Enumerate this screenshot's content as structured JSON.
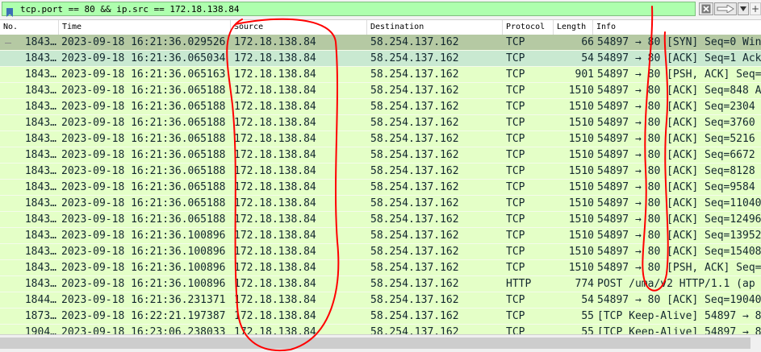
{
  "filter": {
    "expression": "tcp.port == 80 && ip.src == 172.18.138.84"
  },
  "columns": {
    "no": "No.",
    "time": "Time",
    "source": "Source",
    "destination": "Destination",
    "protocol": "Protocol",
    "length": "Length",
    "info": "Info"
  },
  "colors": {
    "filter_valid": "#aeffae",
    "row_tcp": "#e4ffc7",
    "row_selected": "#b5c9a3",
    "row_related": "#c9e9d1",
    "annotation": "#ff0000"
  },
  "packets": [
    {
      "no": "1843…",
      "time": "2023-09-18 16:21:36.029526",
      "source": "172.18.138.84",
      "destination": "58.254.137.162",
      "protocol": "TCP",
      "length": "66",
      "info": "54897 → 80 [SYN] Seq=0 Win",
      "state": "selected"
    },
    {
      "no": "1843…",
      "time": "2023-09-18 16:21:36.065034",
      "source": "172.18.138.84",
      "destination": "58.254.137.162",
      "protocol": "TCP",
      "length": "54",
      "info": "54897 → 80 [ACK] Seq=1 Ack",
      "state": "related"
    },
    {
      "no": "1843…",
      "time": "2023-09-18 16:21:36.065163",
      "source": "172.18.138.84",
      "destination": "58.254.137.162",
      "protocol": "TCP",
      "length": "901",
      "info": "54897 → 80 [PSH, ACK] Seq=",
      "state": "normal"
    },
    {
      "no": "1843…",
      "time": "2023-09-18 16:21:36.065188",
      "source": "172.18.138.84",
      "destination": "58.254.137.162",
      "protocol": "TCP",
      "length": "1510",
      "info": "54897 → 80 [ACK] Seq=848 A",
      "state": "normal"
    },
    {
      "no": "1843…",
      "time": "2023-09-18 16:21:36.065188",
      "source": "172.18.138.84",
      "destination": "58.254.137.162",
      "protocol": "TCP",
      "length": "1510",
      "info": "54897 → 80 [ACK] Seq=2304",
      "state": "normal"
    },
    {
      "no": "1843…",
      "time": "2023-09-18 16:21:36.065188",
      "source": "172.18.138.84",
      "destination": "58.254.137.162",
      "protocol": "TCP",
      "length": "1510",
      "info": "54897 → 80 [ACK] Seq=3760",
      "state": "normal"
    },
    {
      "no": "1843…",
      "time": "2023-09-18 16:21:36.065188",
      "source": "172.18.138.84",
      "destination": "58.254.137.162",
      "protocol": "TCP",
      "length": "1510",
      "info": "54897 → 80 [ACK] Seq=5216",
      "state": "normal"
    },
    {
      "no": "1843…",
      "time": "2023-09-18 16:21:36.065188",
      "source": "172.18.138.84",
      "destination": "58.254.137.162",
      "protocol": "TCP",
      "length": "1510",
      "info": "54897 → 80 [ACK] Seq=6672",
      "state": "normal"
    },
    {
      "no": "1843…",
      "time": "2023-09-18 16:21:36.065188",
      "source": "172.18.138.84",
      "destination": "58.254.137.162",
      "protocol": "TCP",
      "length": "1510",
      "info": "54897 → 80 [ACK] Seq=8128",
      "state": "normal"
    },
    {
      "no": "1843…",
      "time": "2023-09-18 16:21:36.065188",
      "source": "172.18.138.84",
      "destination": "58.254.137.162",
      "protocol": "TCP",
      "length": "1510",
      "info": "54897 → 80 [ACK] Seq=9584",
      "state": "normal"
    },
    {
      "no": "1843…",
      "time": "2023-09-18 16:21:36.065188",
      "source": "172.18.138.84",
      "destination": "58.254.137.162",
      "protocol": "TCP",
      "length": "1510",
      "info": "54897 → 80 [ACK] Seq=11040",
      "state": "normal"
    },
    {
      "no": "1843…",
      "time": "2023-09-18 16:21:36.065188",
      "source": "172.18.138.84",
      "destination": "58.254.137.162",
      "protocol": "TCP",
      "length": "1510",
      "info": "54897 → 80 [ACK] Seq=12496",
      "state": "normal"
    },
    {
      "no": "1843…",
      "time": "2023-09-18 16:21:36.100896",
      "source": "172.18.138.84",
      "destination": "58.254.137.162",
      "protocol": "TCP",
      "length": "1510",
      "info": "54897 → 80 [ACK] Seq=13952",
      "state": "normal"
    },
    {
      "no": "1843…",
      "time": "2023-09-18 16:21:36.100896",
      "source": "172.18.138.84",
      "destination": "58.254.137.162",
      "protocol": "TCP",
      "length": "1510",
      "info": "54897 → 80 [ACK] Seq=15408",
      "state": "normal"
    },
    {
      "no": "1843…",
      "time": "2023-09-18 16:21:36.100896",
      "source": "172.18.138.84",
      "destination": "58.254.137.162",
      "protocol": "TCP",
      "length": "1510",
      "info": "54897 → 80 [PSH, ACK] Seq=",
      "state": "normal"
    },
    {
      "no": "1843…",
      "time": "2023-09-18 16:21:36.100896",
      "source": "172.18.138.84",
      "destination": "58.254.137.162",
      "protocol": "HTTP",
      "length": "774",
      "info": "POST /uma/v2 HTTP/1.1  (ap",
      "state": "normal"
    },
    {
      "no": "1844…",
      "time": "2023-09-18 16:21:36.231371",
      "source": "172.18.138.84",
      "destination": "58.254.137.162",
      "protocol": "TCP",
      "length": "54",
      "info": "54897 → 80 [ACK] Seq=19040",
      "state": "normal"
    },
    {
      "no": "1873…",
      "time": "2023-09-18 16:22:21.197387",
      "source": "172.18.138.84",
      "destination": "58.254.137.162",
      "protocol": "TCP",
      "length": "55",
      "info": "[TCP Keep-Alive] 54897 → 80",
      "state": "normal"
    },
    {
      "no": "1904…",
      "time": "2023-09-18 16:23:06.238033",
      "source": "172.18.138.84",
      "destination": "58.254.137.162",
      "protocol": "TCP",
      "length": "55",
      "info": "[TCP Keep-Alive] 54897 → 80",
      "state": "normal"
    }
  ]
}
